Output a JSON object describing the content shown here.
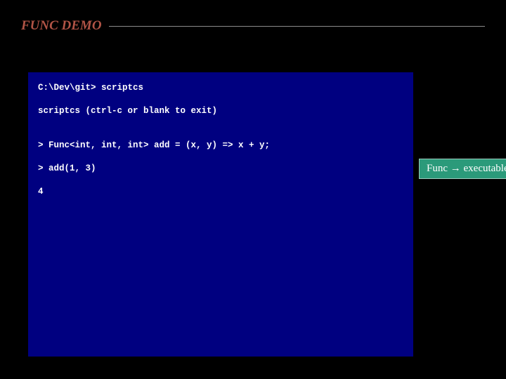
{
  "header": {
    "title": "FUNC DEMO"
  },
  "console": {
    "prompt_line": "C:\\Dev\\git> scriptcs",
    "banner": "scriptcs (ctrl-c or blank to exit)",
    "line1": "> Func<int, int, int> add = (x, y) => x + y;",
    "line2": "> add(1, 3)",
    "result": "4"
  },
  "badge": {
    "left": "Func",
    "arrow": "→",
    "right": "executable"
  },
  "colors": {
    "console_bg": "#000080",
    "header_accent": "#b15446",
    "badge_bg": "#2b9a7a"
  }
}
